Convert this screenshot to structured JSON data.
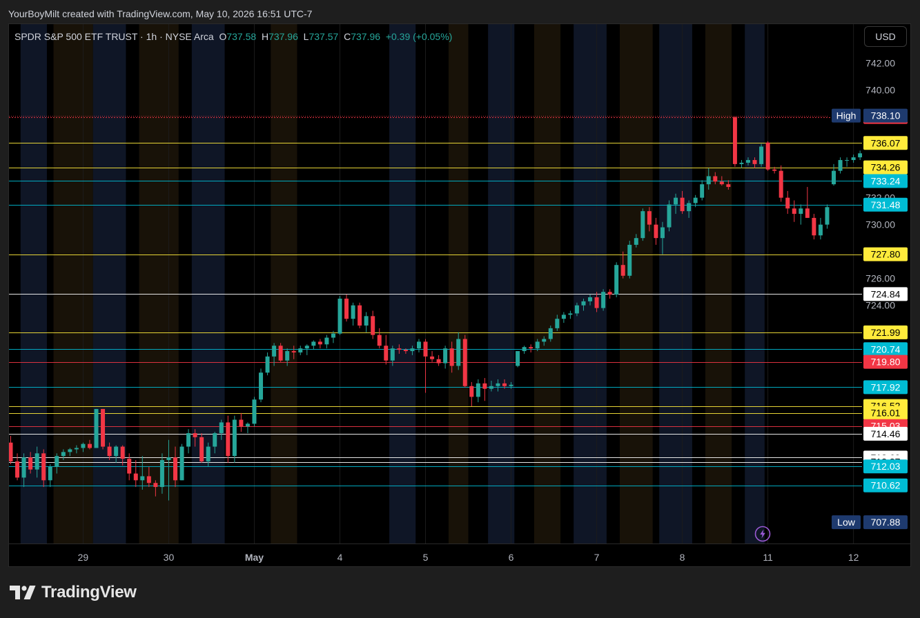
{
  "caption": "YourBoyMilt created with TradingView.com, May 10, 2026 16:51 UTC-7",
  "legend": {
    "symbol": "SPDR S&P 500 ETF TRUST · 1h · NYSE Arca",
    "o_label": "O",
    "o_value": "737.58",
    "h_label": "H",
    "h_value": "737.96",
    "l_label": "L",
    "l_value": "737.57",
    "c_label": "C",
    "c_value": "737.96",
    "change": "+0.39 (+0.05%)"
  },
  "currency": "USD",
  "brand": {
    "name": "TradingView",
    "logo_icon": "tradingview-logo-icon"
  },
  "colors": {
    "up": "#26a69a",
    "down": "#f23645",
    "yellow": "#ffeb3b",
    "cyan": "#00bcd4",
    "white": "#ffffff",
    "navy": "#1e3a6e"
  },
  "chart_data": {
    "type": "candlestick",
    "ylim": [
      706.3,
      744.9
    ],
    "price_ticks": [
      "742.00",
      "740.00",
      "732.00",
      "730.00",
      "726.00",
      "724.00"
    ],
    "date_ticks": [
      {
        "label": "29",
        "bar": 11
      },
      {
        "label": "30",
        "bar": 24
      },
      {
        "label": "May",
        "bar": 37,
        "bold": true
      },
      {
        "label": "4",
        "bar": 50
      },
      {
        "label": "5",
        "bar": 63
      },
      {
        "label": "6",
        "bar": 76
      },
      {
        "label": "7",
        "bar": 89
      },
      {
        "label": "8",
        "bar": 102
      },
      {
        "label": "11",
        "bar": 115
      },
      {
        "label": "12",
        "bar": 128
      }
    ],
    "levels": [
      {
        "value": "738.00",
        "color": "#f23645",
        "dashed": true
      },
      {
        "value": "736.07",
        "color": "#ffeb3b"
      },
      {
        "value": "734.26",
        "color": "#ffeb3b"
      },
      {
        "value": "733.24",
        "color": "#00bcd4"
      },
      {
        "value": "731.48",
        "color": "#00bcd4"
      },
      {
        "value": "727.80",
        "color": "#ffeb3b"
      },
      {
        "value": "724.84",
        "color": "#ffffff"
      },
      {
        "value": "721.99",
        "color": "#ffeb3b"
      },
      {
        "value": "720.74",
        "color": "#00bcd4"
      },
      {
        "value": "719.80",
        "color": "#f23645"
      },
      {
        "value": "717.92",
        "color": "#00bcd4"
      },
      {
        "value": "716.52",
        "color": "#ffeb3b"
      },
      {
        "value": "716.01",
        "color": "#ffeb3b"
      },
      {
        "value": "715.03",
        "color": "#f23645"
      },
      {
        "value": "714.46",
        "color": "#ffffff"
      },
      {
        "value": "712.69",
        "color": "#ffffff"
      },
      {
        "value": "712.37",
        "color": "#ffffff"
      },
      {
        "value": "712.03",
        "color": "#00bcd4"
      },
      {
        "value": "710.62",
        "color": "#00bcd4"
      }
    ],
    "high": {
      "label": "High",
      "value": "738.10"
    },
    "low": {
      "label": "Low",
      "value": "707.88"
    },
    "session_bands": [
      {
        "from": 2,
        "to": 6,
        "kind": "pre"
      },
      {
        "from": 7,
        "to": 13,
        "kind": "post"
      },
      {
        "from": 13,
        "to": 18,
        "kind": "pre"
      },
      {
        "from": 20,
        "to": 26,
        "kind": "post"
      },
      {
        "from": 28,
        "to": 33,
        "kind": "pre"
      },
      {
        "from": 40,
        "to": 44,
        "kind": "post"
      },
      {
        "from": 58,
        "to": 62,
        "kind": "pre"
      },
      {
        "from": 67,
        "to": 70,
        "kind": "post"
      },
      {
        "from": 73,
        "to": 77,
        "kind": "pre"
      },
      {
        "from": 80,
        "to": 84,
        "kind": "post"
      },
      {
        "from": 86,
        "to": 91,
        "kind": "pre"
      },
      {
        "from": 93,
        "to": 98,
        "kind": "post"
      },
      {
        "from": 99,
        "to": 104,
        "kind": "pre"
      },
      {
        "from": 106,
        "to": 110,
        "kind": "post"
      },
      {
        "from": 112,
        "to": 115,
        "kind": "pre"
      }
    ],
    "candles": [
      [
        713.8,
        714.3,
        712.2,
        712.4
      ],
      [
        712.4,
        713.0,
        711.0,
        711.2
      ],
      [
        711.2,
        713.0,
        710.5,
        712.7
      ],
      [
        712.7,
        713.1,
        711.5,
        711.8
      ],
      [
        711.8,
        713.5,
        711.2,
        713.0
      ],
      [
        713.0,
        713.3,
        710.5,
        711.0
      ],
      [
        711.0,
        712.2,
        710.5,
        712.0
      ],
      [
        712.0,
        713.0,
        711.5,
        712.8
      ],
      [
        712.8,
        713.3,
        712.5,
        713.1
      ],
      [
        713.1,
        713.4,
        712.8,
        713.3
      ],
      [
        713.3,
        713.6,
        713.0,
        713.4
      ],
      [
        713.4,
        713.8,
        713.1,
        713.7
      ],
      [
        713.7,
        714.0,
        713.3,
        713.4
      ],
      [
        713.4,
        716.3,
        713.4,
        716.3
      ],
      [
        716.3,
        716.3,
        713.3,
        713.5
      ],
      [
        713.5,
        713.8,
        712.5,
        712.8
      ],
      [
        712.8,
        713.6,
        712.3,
        713.5
      ],
      [
        713.5,
        713.6,
        712.1,
        712.6
      ],
      [
        712.6,
        713.0,
        711.0,
        711.5
      ],
      [
        711.5,
        712.5,
        710.5,
        711.0
      ],
      [
        711.0,
        712.8,
        710.3,
        711.3
      ],
      [
        711.3,
        712.0,
        710.5,
        710.8
      ],
      [
        710.8,
        711.0,
        709.8,
        710.5
      ],
      [
        710.5,
        713.0,
        710.0,
        712.5
      ],
      [
        712.5,
        714.0,
        709.5,
        712.7
      ],
      [
        712.7,
        713.5,
        710.5,
        711.0
      ],
      [
        711.0,
        713.7,
        711.0,
        713.5
      ],
      [
        713.5,
        714.8,
        713.0,
        714.5
      ],
      [
        714.5,
        714.8,
        713.5,
        714.2
      ],
      [
        714.2,
        714.5,
        712.3,
        712.4
      ],
      [
        712.4,
        713.8,
        712.0,
        713.5
      ],
      [
        713.5,
        714.6,
        713.0,
        714.5
      ],
      [
        714.5,
        715.5,
        714.0,
        715.3
      ],
      [
        715.3,
        715.8,
        712.3,
        712.8
      ],
      [
        712.8,
        715.8,
        712.3,
        715.5
      ],
      [
        715.5,
        716.0,
        714.6,
        715.0
      ],
      [
        715.0,
        715.3,
        714.5,
        715.2
      ],
      [
        715.2,
        717.2,
        715.0,
        717.0
      ],
      [
        717.0,
        719.3,
        716.8,
        719.0
      ],
      [
        719.0,
        720.5,
        718.8,
        720.2
      ],
      [
        720.2,
        721.2,
        719.5,
        721.0
      ],
      [
        721.0,
        721.2,
        719.8,
        719.9
      ],
      [
        719.9,
        720.8,
        719.5,
        720.6
      ],
      [
        720.6,
        721.0,
        720.0,
        720.5
      ],
      [
        720.5,
        721.0,
        720.3,
        720.8
      ],
      [
        720.8,
        721.1,
        720.3,
        721.0
      ],
      [
        721.0,
        721.4,
        720.7,
        721.3
      ],
      [
        721.3,
        721.5,
        720.8,
        721.1
      ],
      [
        721.1,
        721.8,
        720.8,
        721.6
      ],
      [
        721.6,
        722.1,
        721.2,
        721.9
      ],
      [
        721.9,
        724.7,
        721.8,
        724.5
      ],
      [
        724.5,
        724.8,
        722.8,
        723.0
      ],
      [
        723.0,
        724.2,
        722.5,
        724.0
      ],
      [
        724.0,
        724.2,
        722.3,
        722.5
      ],
      [
        722.5,
        723.5,
        722.0,
        723.2
      ],
      [
        723.2,
        723.6,
        721.5,
        721.8
      ],
      [
        721.8,
        722.3,
        720.8,
        721.0
      ],
      [
        721.0,
        721.8,
        719.6,
        719.9
      ],
      [
        719.9,
        721.0,
        719.5,
        720.8
      ],
      [
        720.8,
        721.1,
        720.4,
        720.7
      ],
      [
        720.7,
        720.8,
        720.4,
        720.6
      ],
      [
        720.6,
        721.0,
        720.3,
        720.8
      ],
      [
        720.8,
        721.5,
        720.5,
        721.3
      ],
      [
        721.3,
        721.5,
        717.5,
        720.2
      ],
      [
        720.2,
        720.6,
        719.8,
        720.0
      ],
      [
        720.0,
        720.3,
        719.5,
        719.7
      ],
      [
        719.7,
        721.0,
        719.3,
        720.8
      ],
      [
        720.8,
        721.3,
        719.0,
        719.5
      ],
      [
        719.5,
        722.0,
        719.2,
        721.5
      ],
      [
        721.5,
        721.8,
        717.9,
        718.0
      ],
      [
        718.0,
        718.3,
        716.5,
        717.2
      ],
      [
        717.2,
        718.5,
        716.8,
        718.2
      ],
      [
        718.2,
        718.6,
        716.9,
        717.8
      ],
      [
        717.8,
        718.4,
        717.6,
        718.0
      ],
      [
        718.0,
        718.5,
        717.6,
        718.2
      ],
      [
        718.2,
        718.5,
        717.8,
        718.0
      ],
      [
        718.0,
        718.3,
        717.8,
        718.1
      ],
      [
        719.5,
        720.6,
        719.4,
        720.6
      ],
      [
        720.6,
        721.0,
        720.4,
        720.9
      ],
      [
        720.9,
        721.1,
        720.5,
        720.8
      ],
      [
        720.8,
        721.5,
        720.6,
        721.3
      ],
      [
        721.3,
        721.7,
        721.0,
        721.5
      ],
      [
        721.5,
        722.5,
        721.3,
        722.3
      ],
      [
        722.3,
        723.3,
        722.1,
        723.0
      ],
      [
        723.0,
        723.5,
        722.7,
        723.3
      ],
      [
        723.3,
        723.6,
        723.0,
        723.4
      ],
      [
        723.4,
        724.2,
        723.2,
        724.0
      ],
      [
        724.0,
        724.5,
        723.6,
        724.3
      ],
      [
        724.3,
        724.8,
        724.0,
        724.6
      ],
      [
        724.6,
        725.0,
        723.5,
        723.8
      ],
      [
        723.8,
        725.2,
        723.6,
        725.0
      ],
      [
        725.0,
        725.2,
        724.5,
        724.8
      ],
      [
        724.8,
        727.2,
        724.6,
        727.0
      ],
      [
        727.0,
        728.0,
        726.0,
        726.2
      ],
      [
        726.2,
        728.8,
        726.0,
        728.5
      ],
      [
        728.5,
        729.3,
        728.3,
        729.0
      ],
      [
        729.0,
        731.2,
        728.8,
        731.0
      ],
      [
        731.0,
        731.3,
        729.5,
        730.0
      ],
      [
        730.0,
        730.5,
        728.5,
        729.0
      ],
      [
        729.0,
        730.2,
        727.8,
        729.8
      ],
      [
        729.8,
        731.8,
        729.5,
        731.5
      ],
      [
        731.5,
        732.3,
        730.8,
        732.0
      ],
      [
        732.0,
        732.5,
        730.8,
        731.0
      ],
      [
        731.0,
        731.8,
        730.5,
        731.6
      ],
      [
        731.6,
        732.2,
        731.3,
        732.0
      ],
      [
        732.0,
        733.3,
        731.8,
        733.0
      ],
      [
        733.0,
        734.2,
        732.6,
        733.6
      ],
      [
        733.6,
        733.9,
        733.0,
        733.2
      ],
      [
        733.2,
        733.6,
        732.9,
        733.0
      ],
      [
        733.0,
        733.3,
        732.6,
        732.8
      ],
      [
        738.0,
        738.0,
        734.3,
        734.5
      ],
      [
        734.5,
        734.8,
        734.2,
        734.6
      ],
      [
        734.6,
        735.0,
        734.4,
        734.8
      ],
      [
        734.8,
        735.0,
        734.2,
        734.5
      ],
      [
        734.5,
        736.0,
        734.3,
        735.8
      ],
      [
        736.1,
        736.2,
        734.0,
        734.1
      ],
      [
        734.1,
        734.3,
        733.8,
        734.0
      ],
      [
        734.0,
        734.4,
        731.7,
        732.0
      ],
      [
        732.0,
        732.5,
        730.8,
        731.2
      ],
      [
        731.2,
        731.8,
        730.2,
        730.8
      ],
      [
        730.8,
        731.5,
        730.0,
        731.2
      ],
      [
        731.2,
        732.8,
        730.5,
        730.5
      ],
      [
        730.5,
        730.8,
        728.9,
        729.2
      ],
      [
        729.2,
        730.5,
        728.9,
        730.0
      ],
      [
        730.0,
        731.5,
        729.7,
        731.3
      ],
      [
        733.0,
        734.5,
        732.9,
        734.0
      ],
      [
        734.0,
        735.0,
        733.8,
        734.8
      ],
      [
        734.8,
        735.0,
        734.3,
        734.8
      ],
      [
        734.8,
        735.2,
        734.6,
        735.0
      ],
      [
        735.0,
        735.5,
        734.8,
        735.3
      ],
      [
        735.3,
        735.6,
        735.0,
        735.2
      ],
      [
        735.2,
        737.0,
        734.6,
        736.8
      ],
      [
        736.8,
        737.6,
        736.5,
        737.3
      ],
      [
        737.3,
        737.5,
        736.8,
        737.0
      ],
      [
        737.0,
        737.8,
        736.6,
        737.2
      ],
      [
        737.2,
        738.2,
        736.8,
        736.3
      ],
      [
        736.3,
        738.0,
        736.0,
        737.8
      ],
      [
        737.8,
        738.0,
        737.3,
        737.5
      ],
      [
        737.5,
        738.0,
        737.2,
        737.6
      ],
      [
        737.6,
        738.0,
        737.4,
        737.7
      ],
      [
        737.58,
        737.96,
        737.57,
        737.96
      ]
    ]
  }
}
